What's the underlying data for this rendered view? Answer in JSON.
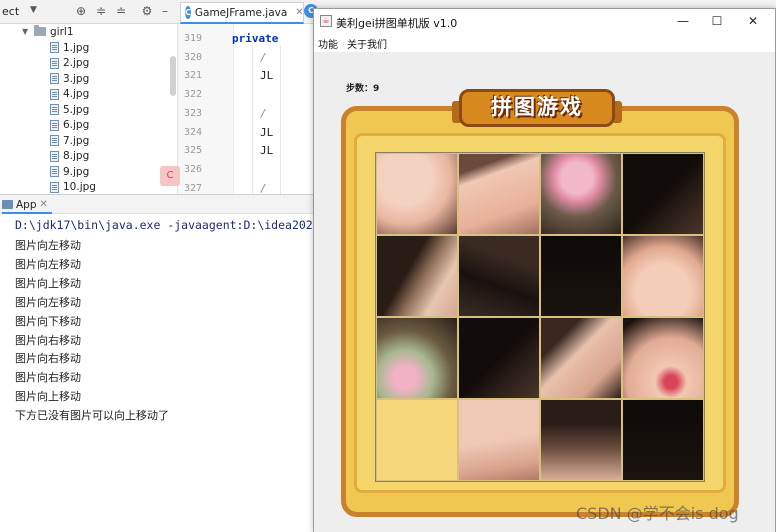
{
  "ide": {
    "project_label": "ect",
    "folder": "girl1",
    "files": [
      "1.jpg",
      "2.jpg",
      "3.jpg",
      "4.jpg",
      "5.jpg",
      "6.jpg",
      "7.jpg",
      "8.jpg",
      "9.jpg",
      "10.jpg"
    ],
    "tab_title": "GameJFrame.java",
    "line_numbers": [
      "319",
      "320",
      "321",
      "322",
      "323",
      "324",
      "325",
      "326",
      "327"
    ],
    "code_lines": [
      "private",
      "/",
      "JL",
      "",
      "/",
      "JL",
      "JL",
      "",
      "/"
    ],
    "run_tab": "App",
    "console": {
      "command": "D:\\jdk17\\bin\\java.exe -javaagent:D:\\idea2022",
      "lines": [
        "图片向左移动",
        "图片向左移动",
        "图片向上移动",
        "图片向左移动",
        "图片向下移动",
        "图片向右移动",
        "图片向右移动",
        "图片向右移动",
        "图片向上移动",
        "下方已没有图片可以向上移动了"
      ],
      "edge_char": "v"
    }
  },
  "game": {
    "window_title": "美利gei拼图单机版 v1.0",
    "menus": [
      "功能",
      "关于我们"
    ],
    "steps_text": "步数：9",
    "banner_text": "拼图游戏",
    "tiles": [
      {
        "id": 1,
        "tone": "face-lower"
      },
      {
        "id": 2,
        "tone": "face-eye"
      },
      {
        "id": 3,
        "tone": "flower-hair"
      },
      {
        "id": 4,
        "tone": "dark-hair"
      },
      {
        "id": 5,
        "tone": "hair-strand"
      },
      {
        "id": 6,
        "tone": "hair-dark"
      },
      {
        "id": 7,
        "tone": "dark"
      },
      {
        "id": 8,
        "tone": "cheek"
      },
      {
        "id": 9,
        "tone": "flower-blur"
      },
      {
        "id": 10,
        "tone": "dark-hair"
      },
      {
        "id": 11,
        "tone": "forehead"
      },
      {
        "id": 12,
        "tone": "lips"
      },
      {
        "id": 0,
        "tone": "empty"
      },
      {
        "id": 13,
        "tone": "chin"
      },
      {
        "id": 14,
        "tone": "hair-top"
      },
      {
        "id": 15,
        "tone": "dark"
      }
    ],
    "colors": {
      "frame": "#f0c750",
      "frame_border": "#c9822c",
      "banner": "#d8891d",
      "empty_tile": "#f5d67a"
    }
  },
  "watermark": "CSDN @学不会is dog"
}
